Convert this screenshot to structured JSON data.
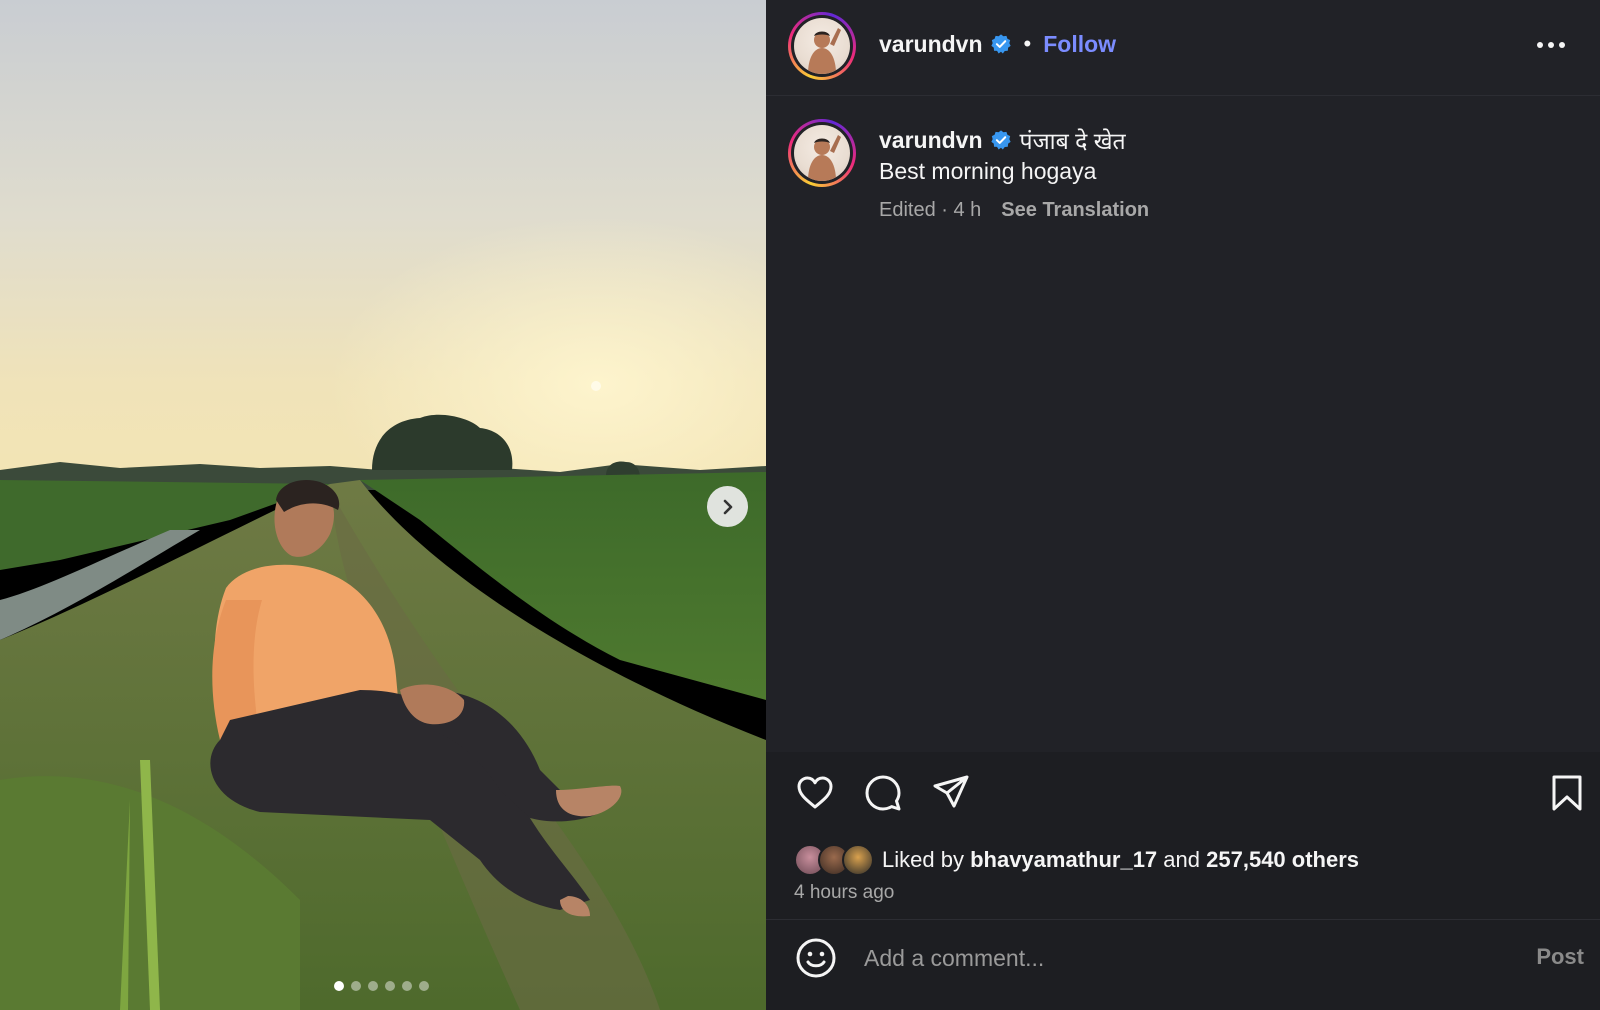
{
  "post": {
    "username": "varundvn",
    "follow_label": "Follow",
    "separator": "•",
    "caption": {
      "username": "varundvn",
      "title": "पंजाब दे खेत",
      "text": "Best morning hogaya",
      "edited": "Edited · 4 h",
      "see_translation": "See Translation"
    },
    "likes": {
      "prefix": "Liked by",
      "user": "bhavyamathur_17",
      "and": "and",
      "others": "257,540 others"
    },
    "time_ago": "4 hours ago",
    "comment": {
      "placeholder": "Add a comment...",
      "post_label": "Post"
    },
    "carousel": {
      "slides": 6,
      "current": 1
    }
  },
  "colors": {
    "panel_bg": "#212227",
    "follow": "#7b8cff",
    "verified": "#3897f0",
    "muted": "#a8a8a8"
  },
  "icons": [
    "verified-badge-icon",
    "more-options-icon",
    "heart-icon",
    "comment-icon",
    "share-icon",
    "bookmark-icon",
    "emoji-icon",
    "chevron-right-icon"
  ]
}
